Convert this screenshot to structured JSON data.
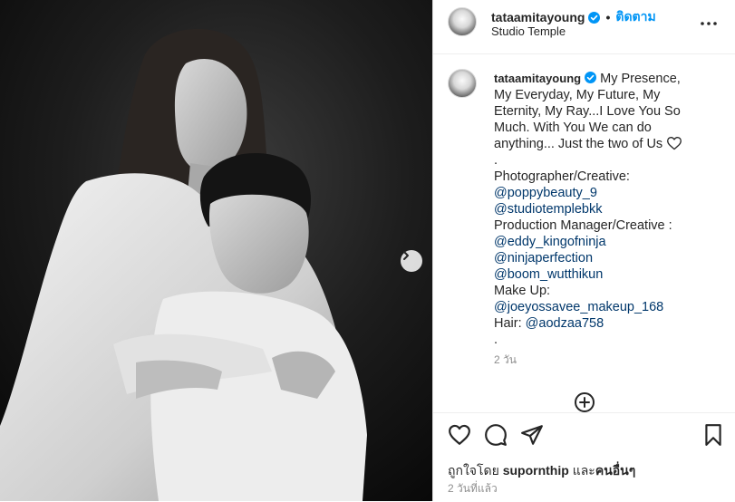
{
  "header": {
    "username": "tataamitayoung",
    "follow_label": "ติดตาม",
    "location": "Studio Temple"
  },
  "caption": {
    "username": "tataamitayoung",
    "line1": "My Presence,",
    "line2": "My Everyday, My Future, My",
    "line3": "Eternity, My Ray...I Love You So",
    "line4": "Much. With You We can do",
    "line5": "anything... Just the two of Us",
    "dot1": ".",
    "photographer_label": "Photographer/Creative:",
    "mention1": "@poppybeauty_9",
    "mention2": "@studiotemplebkk",
    "production_label": "Production Manager/Creative :",
    "mention3": "@eddy_kingofninja",
    "mention4": "@ninjaperfection",
    "mention5": "@boom_wutthikun",
    "makeup_label": "Make Up:",
    "mention6": "@joeyossavee_makeup_168",
    "hair_label": "Hair:",
    "mention7": "@aodzaa758",
    "dot2": ".",
    "time": "2 วัน"
  },
  "likes": {
    "prefix": "ถูกใจโดย",
    "user": "supornthip",
    "middle": "และ",
    "others": "คนอื่นๆ"
  },
  "date": "2 วันที่แล้ว",
  "icons": {
    "verified": "verified-badge-icon",
    "more": "more-options-icon",
    "next": "chevron-right-icon",
    "load_more": "plus-circle-icon",
    "like": "heart-icon",
    "comment": "comment-icon",
    "share": "paper-plane-icon",
    "save": "bookmark-icon"
  },
  "colors": {
    "accent": "#0095f6",
    "mention": "#00376b",
    "muted": "#8e8e8e"
  }
}
